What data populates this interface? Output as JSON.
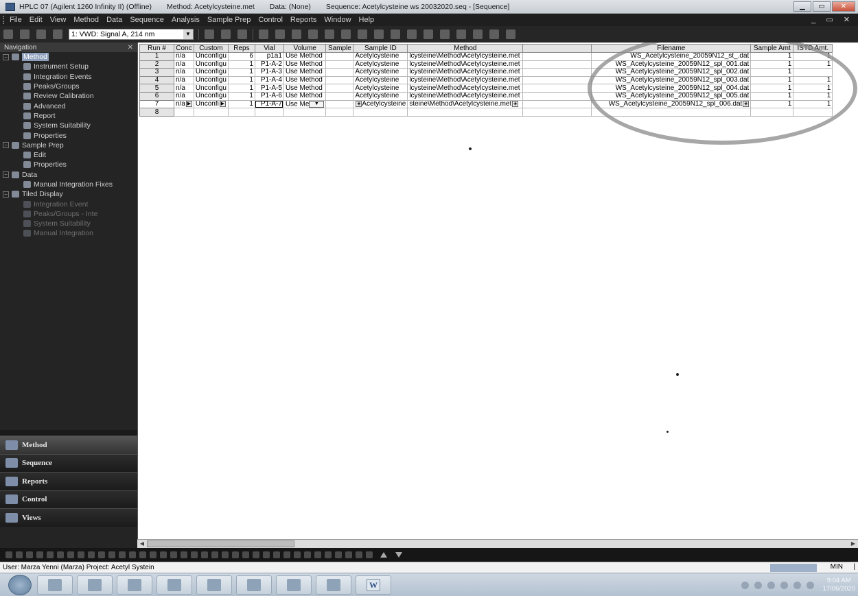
{
  "titlebar": {
    "app": "HPLC 07 (Agilent 1260 Infinity II) (Offline)",
    "method": "Method: Acetylcysteine.met",
    "data": "Data: (None)",
    "sequence": "Sequence: Acetylcysteine ws 20032020.seq - [Sequence]"
  },
  "menu": [
    "File",
    "Edit",
    "View",
    "Method",
    "Data",
    "Sequence",
    "Analysis",
    "Sample Prep",
    "Control",
    "Reports",
    "Window",
    "Help"
  ],
  "toolbar": {
    "signal": "1: VWD: Signal A, 214 nm"
  },
  "navigation": {
    "title": "Navigation",
    "items": [
      {
        "label": "Method",
        "level": 0,
        "expander": "−",
        "selected": true
      },
      {
        "label": "Instrument Setup",
        "level": 2,
        "dim": false
      },
      {
        "label": "Integration Events",
        "level": 2
      },
      {
        "label": "Peaks/Groups",
        "level": 2
      },
      {
        "label": "Review Calibration",
        "level": 2
      },
      {
        "label": "Advanced",
        "level": 2
      },
      {
        "label": "Report",
        "level": 2
      },
      {
        "label": "System Suitability",
        "level": 2
      },
      {
        "label": "Properties",
        "level": 2
      },
      {
        "label": "Sample Prep",
        "level": 0,
        "expander": "−"
      },
      {
        "label": "Edit",
        "level": 2
      },
      {
        "label": "Properties",
        "level": 2
      },
      {
        "label": "Data",
        "level": 0,
        "expander": "−"
      },
      {
        "label": "Manual Integration Fixes",
        "level": 2
      },
      {
        "label": "Tiled Display",
        "level": 0,
        "expander": "−"
      },
      {
        "label": "Integration Event",
        "level": 2,
        "dim": true
      },
      {
        "label": "Peaks/Groups - Inte",
        "level": 2,
        "dim": true
      },
      {
        "label": "System Suitability",
        "level": 2,
        "dim": true
      },
      {
        "label": "Manual Integration",
        "level": 2,
        "dim": true
      }
    ],
    "buttons": [
      "Method",
      "Sequence",
      "Reports",
      "Control",
      "Views"
    ]
  },
  "table": {
    "headers": [
      "Run #",
      "Conc",
      "Custom",
      "Reps",
      "Vial",
      "Volume",
      "Sample",
      "Sample ID",
      "Method",
      "",
      "Filename",
      "Sample Amt",
      "ISTD Amt."
    ],
    "rows": [
      {
        "run": "1",
        "conc": "n/a",
        "custom": "Unconfigu",
        "reps": "6",
        "vial": "p1a1",
        "volume": "Use Method",
        "sample": "",
        "sample_id": "Acetylcysteine",
        "method": "lcysteine\\Method\\Acetylcysteine.met",
        "filename": "WS_Acetylcysteine_20059N12_st_.dat",
        "amt": "1",
        "istd": "1"
      },
      {
        "run": "2",
        "conc": "n/a",
        "custom": "Unconfigu",
        "reps": "1",
        "vial": "P1-A-2",
        "volume": "Use Method",
        "sample": "",
        "sample_id": "Acetylcysteine",
        "method": "lcysteine\\Method\\Acetylcysteine.met",
        "filename": "WS_Acetylcysteine_20059N12_spl_001.dat",
        "amt": "1",
        "istd": "1"
      },
      {
        "run": "3",
        "conc": "n/a",
        "custom": "Unconfigu",
        "reps": "1",
        "vial": "P1-A-3",
        "volume": "Use Method",
        "sample": "",
        "sample_id": "Acetylcysteine",
        "method": "lcysteine\\Method\\Acetylcysteine.met",
        "filename": "WS_Acetylcysteine_20059N12_spl_002.dat",
        "amt": "1",
        "istd": ""
      },
      {
        "run": "4",
        "conc": "n/a",
        "custom": "Unconfigu",
        "reps": "1",
        "vial": "P1-A-4",
        "volume": "Use Method",
        "sample": "",
        "sample_id": "Acetylcysteine",
        "method": "lcysteine\\Method\\Acetylcysteine.met",
        "filename": "WS_Acetylcysteine_20059N12_spl_003.dat",
        "amt": "1",
        "istd": "1"
      },
      {
        "run": "5",
        "conc": "n/a",
        "custom": "Unconfigu",
        "reps": "1",
        "vial": "P1-A-5",
        "volume": "Use Method",
        "sample": "",
        "sample_id": "Acetylcysteine",
        "method": "lcysteine\\Method\\Acetylcysteine.met",
        "filename": "WS_Acetylcysteine_20059N12_spl_004.dat",
        "amt": "1",
        "istd": "1"
      },
      {
        "run": "6",
        "conc": "n/a",
        "custom": "Unconfigu",
        "reps": "1",
        "vial": "P1-A-6",
        "volume": "Use Method",
        "sample": "",
        "sample_id": "Acetylcysteine",
        "method": "lcysteine\\Method\\Acetylcysteine.met",
        "filename": "WS_Acetylcysteine_20059N12_spl_005.dat",
        "amt": "1",
        "istd": "1"
      },
      {
        "run": "7",
        "conc": "n/a",
        "custom": "Unconfi",
        "reps": "1",
        "vial": "P1-A-7",
        "volume": "Use Me",
        "sample": "",
        "sample_id": "Acetylcysteine",
        "method": "steine\\Method\\Acetylcysteine.met",
        "filename": "WS_Acetylcysteine_20059N12_spl_006.dat",
        "amt": "1",
        "istd": "1",
        "editing": true
      },
      {
        "run": "8",
        "conc": "",
        "custom": "",
        "reps": "",
        "vial": "",
        "volume": "",
        "sample": "",
        "sample_id": "",
        "method": "",
        "filename": "",
        "amt": "",
        "istd": ""
      }
    ]
  },
  "status": {
    "user": "User: Marza Yenni (Marza)  Project: Acetyl Systein",
    "mode": "MIN"
  },
  "taskbar": {
    "word_label": "W",
    "time": "9:04 AM",
    "date": "17/06/2020"
  },
  "colors": {
    "annotation_circle": "#8a8a8a",
    "nav_selected": "#8fa0bc",
    "dark_ui": "#242424"
  }
}
